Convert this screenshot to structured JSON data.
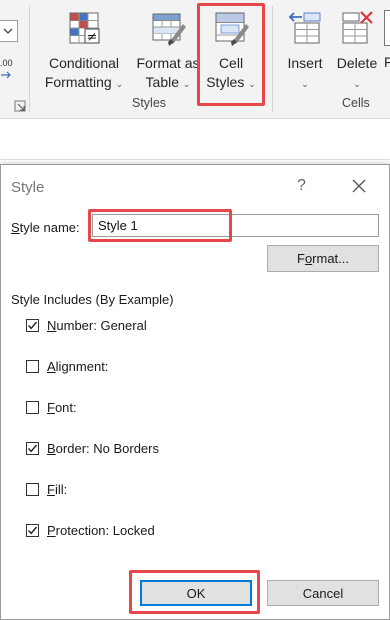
{
  "ribbon": {
    "conditional_formatting": {
      "line1": "Conditional",
      "line2": "Formatting",
      "caret": "⌄",
      "icon": "conditional-formatting-icon"
    },
    "format_as_table": {
      "line1": "Format as",
      "line2": "Table",
      "caret": "⌄",
      "icon": "format-as-table-icon"
    },
    "cell_styles": {
      "line1": "Cell",
      "line2": "Styles",
      "caret": "⌄",
      "icon": "cell-styles-icon"
    },
    "insert": {
      "line1": "Insert",
      "caret": "⌄",
      "icon": "insert-cells-icon"
    },
    "delete": {
      "line1": "Delete",
      "caret": "⌄",
      "icon": "delete-cells-icon"
    },
    "format_partial": "F",
    "left_partial": ".00",
    "groups": {
      "styles": "Styles",
      "cells": "Cells"
    }
  },
  "dialog": {
    "title": "Style",
    "help": "?",
    "style_name_label_u": "S",
    "style_name_label_rest": "tyle name:",
    "style_name_value": "Style 1",
    "format_button_pre": "F",
    "format_button_u": "o",
    "format_button_post": "rmat...",
    "includes_label": "Style Includes (By Example)",
    "options": [
      {
        "u": "N",
        "rest": "umber: General",
        "checked": true
      },
      {
        "u": "A",
        "rest": "lignment:",
        "checked": false
      },
      {
        "u": "F",
        "rest": "ont:",
        "checked": false
      },
      {
        "u": "B",
        "rest": "order: No Borders",
        "checked": true
      },
      {
        "u": "F",
        "rest": "ill:",
        "checked": false
      },
      {
        "u": "P",
        "rest": "rotection: Locked",
        "checked": true
      }
    ],
    "ok_label": "OK",
    "cancel_label": "Cancel"
  },
  "colors": {
    "highlight": "#e8474a",
    "accent": "#0078d7",
    "ribbon_bg": "#f3f3f3"
  }
}
